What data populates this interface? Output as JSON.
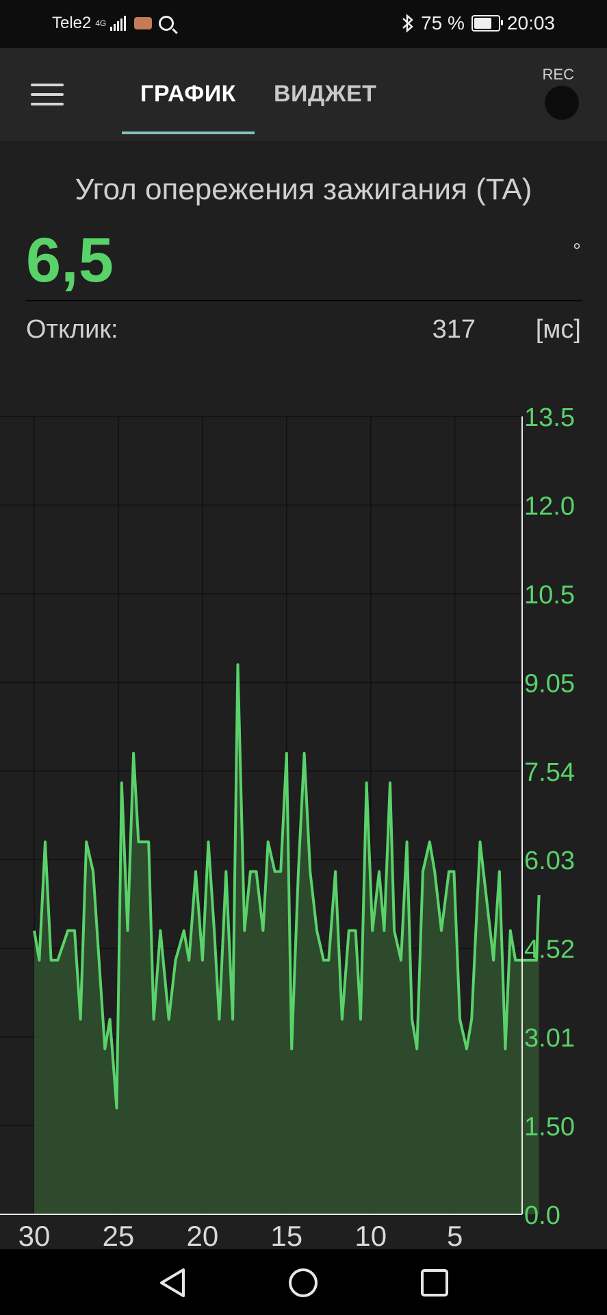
{
  "status_bar": {
    "carrier": "Tele2",
    "network": "4G",
    "bluetooth_icon": "bluetooth-icon",
    "battery": "75 %",
    "battery_level": 0.75,
    "time": "20:03"
  },
  "app_bar": {
    "menu_icon": "hamburger-menu-icon",
    "tabs": [
      {
        "label": "ГРАФИК",
        "active": true
      },
      {
        "label": "ВИДЖЕТ",
        "active": false
      }
    ],
    "rec_label": "REC",
    "accent": "#7fc4c0"
  },
  "sensor": {
    "title": "Угол опережения зажигания (TA)",
    "value": "6,5",
    "unit": "°",
    "response_label": "Отклик:",
    "response_value": "317",
    "response_unit": "[мс]",
    "value_color": "#5ad26a"
  },
  "chart_data": {
    "type": "area",
    "y_ticks": [
      "0.0",
      "1.50",
      "3.01",
      "4.52",
      "6.03",
      "7.54",
      "9.05",
      "10.5",
      "12.0",
      "13.5"
    ],
    "x_ticks": [
      "30",
      "25",
      "20",
      "15",
      "10",
      "5"
    ],
    "ylim": [
      0,
      13.5
    ],
    "xlim": [
      30,
      1
    ],
    "grid": true,
    "line_color": "#5ad26a",
    "fill_color": "#2f4f2f",
    "x": [
      30,
      29.7,
      29.35,
      29,
      28.6,
      28,
      27.6,
      27.25,
      26.9,
      26.5,
      25.8,
      25.5,
      25.1,
      24.8,
      24.45,
      24.1,
      23.8,
      23.2,
      22.9,
      22.5,
      22,
      21.6,
      21.1,
      20.8,
      20.4,
      20,
      19.65,
      19.3,
      19,
      18.6,
      18.2,
      17.9,
      17.5,
      17.15,
      16.8,
      16.4,
      16.1,
      15.7,
      15.35,
      15,
      14.7,
      14.3,
      13.95,
      13.6,
      13.2,
      12.8,
      12.5,
      12.1,
      11.7,
      11.3,
      10.9,
      10.6,
      10.25,
      9.9,
      9.5,
      9.2,
      8.85,
      8.6,
      8.2,
      7.85,
      7.55,
      7.25,
      6.9,
      6.5,
      6.2,
      5.8,
      5.35,
      5.05,
      4.7,
      4.3,
      4,
      3.5,
      2.7,
      2.35,
      2,
      1.7,
      1.4,
      1.1,
      0.8,
      0.45,
      0.15,
      0
    ],
    "values": [
      4.8,
      4.3,
      6.3,
      4.3,
      4.3,
      4.8,
      4.8,
      3.3,
      6.3,
      5.8,
      2.8,
      3.3,
      1.8,
      7.3,
      4.8,
      7.8,
      6.3,
      6.3,
      3.3,
      4.8,
      3.3,
      4.3,
      4.8,
      4.3,
      5.8,
      4.3,
      6.3,
      4.8,
      3.3,
      5.8,
      3.3,
      9.3,
      4.8,
      5.8,
      5.8,
      4.8,
      6.3,
      5.8,
      5.8,
      7.8,
      2.8,
      5.8,
      7.8,
      5.8,
      4.8,
      4.3,
      4.3,
      5.8,
      3.3,
      4.8,
      4.8,
      3.3,
      7.3,
      4.8,
      5.8,
      4.8,
      7.3,
      4.8,
      4.3,
      6.3,
      3.3,
      2.8,
      5.8,
      6.3,
      5.8,
      4.8,
      5.8,
      5.8,
      3.3,
      2.8,
      3.3,
      6.3,
      4.3,
      5.8,
      2.8,
      4.8,
      4.3,
      4.3,
      4.3,
      4.3,
      4.3,
      5.4
    ]
  },
  "nav_bar": {
    "back_icon": "back-triangle-icon",
    "home_icon": "home-circle-icon",
    "recent_icon": "recent-square-icon"
  }
}
